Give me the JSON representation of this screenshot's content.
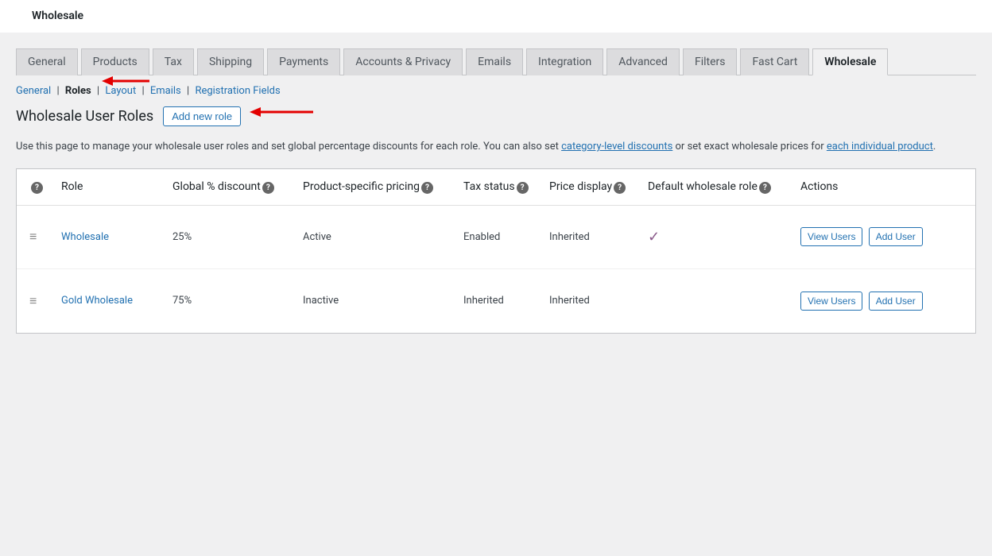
{
  "top_title": "Wholesale",
  "tabs": [
    "General",
    "Products",
    "Tax",
    "Shipping",
    "Payments",
    "Accounts & Privacy",
    "Emails",
    "Integration",
    "Advanced",
    "Filters",
    "Fast Cart",
    "Wholesale"
  ],
  "active_tab": "Wholesale",
  "subnav": {
    "items": [
      "General",
      "Roles",
      "Layout",
      "Emails",
      "Registration Fields"
    ],
    "active": "Roles"
  },
  "page_heading": "Wholesale User Roles",
  "add_button": "Add new role",
  "helper": {
    "p1": "Use this page to manage your wholesale user roles and set global percentage discounts for each role. You can also set ",
    "link1": "category-level discounts",
    "p2": " or set exact wholesale prices for ",
    "link2": "each individual product",
    "p3": "."
  },
  "columns": {
    "role": "Role",
    "discount": "Global % discount",
    "psp": "Product-specific pricing",
    "tax": "Tax status",
    "price_display": "Price display",
    "default": "Default wholesale role",
    "actions": "Actions"
  },
  "rows": [
    {
      "role": "Wholesale",
      "discount": "25%",
      "psp": "Active",
      "tax": "Enabled",
      "pd": "Inherited",
      "default": true
    },
    {
      "role": "Gold Wholesale",
      "discount": "75%",
      "psp": "Inactive",
      "tax": "Inherited",
      "pd": "Inherited",
      "default": false
    }
  ],
  "row_actions": {
    "view": "View Users",
    "add": "Add User"
  }
}
